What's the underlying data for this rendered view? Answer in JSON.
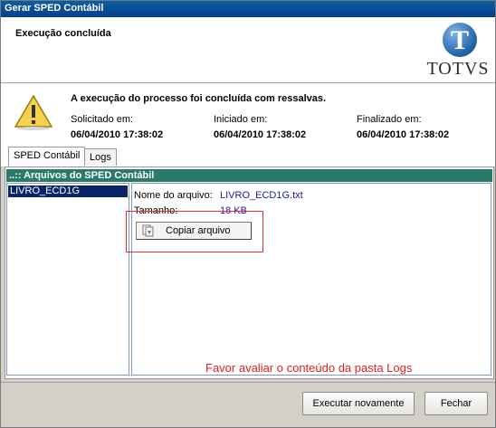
{
  "window": {
    "title": "Gerar SPED Contábil"
  },
  "header": {
    "subtitle": "Execução concluída",
    "brand": "TOTVS"
  },
  "info": {
    "message": "A execução do processo foi concluída com ressalvas.",
    "requested": {
      "label": "Solicitado em:",
      "value": "06/04/2010 17:38:02"
    },
    "started": {
      "label": "Iniciado em:",
      "value": "06/04/2010 17:38:02"
    },
    "finished": {
      "label": "Finalizado em:",
      "value": "06/04/2010 17:38:02"
    }
  },
  "tabs": [
    {
      "label": "SPED Contábil"
    },
    {
      "label": "Logs"
    }
  ],
  "panel": {
    "title": "..:: Arquivos do SPED Contábil",
    "files": [
      "LIVRO_ECD1G"
    ],
    "detail": {
      "name_label": "Nome do arquivo:",
      "name_value": "LIVRO_ECD1G.txt",
      "size_label": "Tamanho:",
      "size_value": "18 KB",
      "copy_button": "Copiar arquivo"
    },
    "note": "Favor avaliar o conteúdo da pasta Logs"
  },
  "footer": {
    "run_again": "Executar novamente",
    "close": "Fechar"
  },
  "colors": {
    "accent": "#2a7a6a",
    "selection": "#0a246a",
    "warning_text": "#e02020"
  }
}
